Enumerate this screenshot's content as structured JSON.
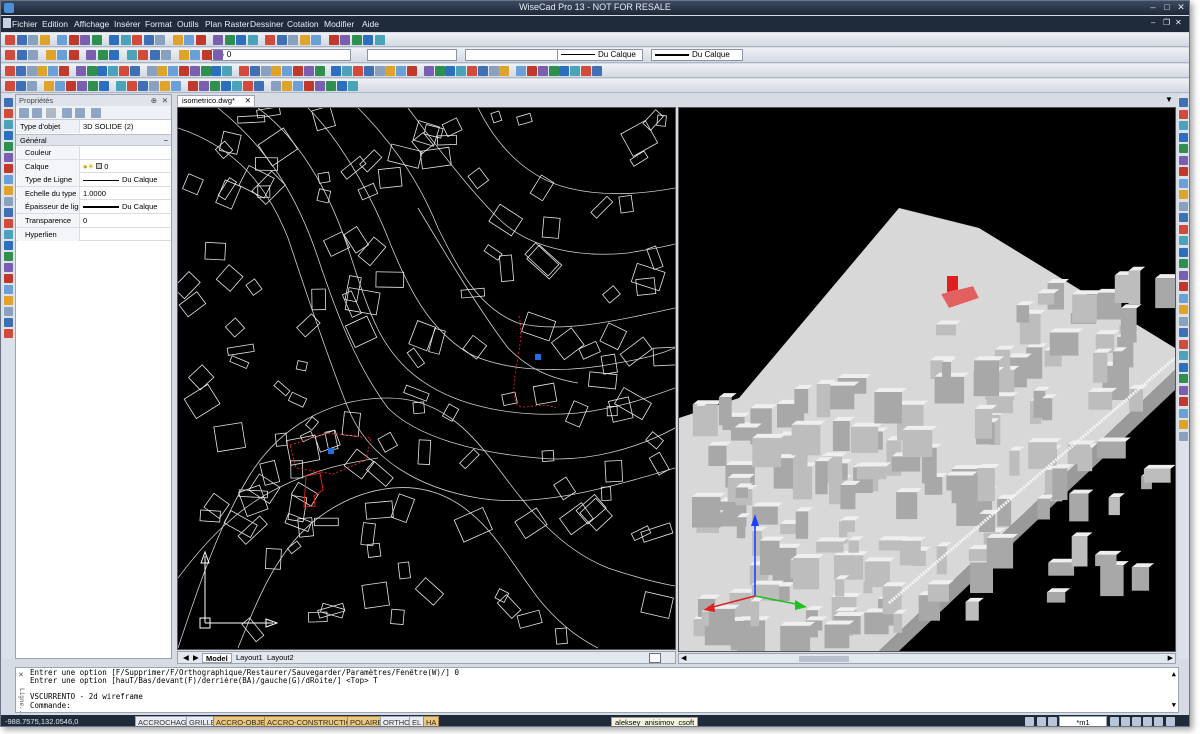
{
  "window": {
    "title": "WiseCad Pro 13 - NOT FOR RESALE",
    "accent": "#1f2a3a"
  },
  "menu": [
    "Fichier",
    "Edition",
    "Affichage",
    "Insérer",
    "Format",
    "Outils",
    "Plan Raster",
    "Dessiner",
    "Cotation",
    "Modifier",
    "Aide"
  ],
  "toolbar": {
    "layer_combo_value": "0",
    "linetype_combo": "Du Calque",
    "lineweight_combo": "Du Calque"
  },
  "properties": {
    "panel_title": "Propriétés",
    "object_type_label": "Type d'objet",
    "object_type_value": "3D SOLIDE (2)",
    "group_general": "Général",
    "rows": [
      {
        "key": "Couleur",
        "value": ""
      },
      {
        "key": "Calque",
        "value": "0"
      },
      {
        "key": "Type de Ligne",
        "value": "Du Calque"
      },
      {
        "key": "Echelle du type ...",
        "value": "1.0000"
      },
      {
        "key": "Épaisseur de ligne",
        "value": "Du Calque"
      },
      {
        "key": "Transparence",
        "value": "0"
      },
      {
        "key": "Hyperlien",
        "value": ""
      }
    ]
  },
  "document": {
    "tab_title": "isometrico.dwg*",
    "layout_tabs": [
      "Model",
      "Layout1",
      "Layout2"
    ]
  },
  "command": {
    "lines": [
      "Entrer une option [F/Supprimer/F/Orthographique/Restaurer/Sauvegarder/Paramètres/Fenêtre(W)/] 0",
      "Entrer une option [hauT/Bas/devant(F)/derrière(BA)/gauche(G)/dRoite/] <Top> T",
      "",
      "VSCURRENTO - 2d wireframe"
    ],
    "prompt": "Commande:",
    "side_label": "Ligne..."
  },
  "status": {
    "coords": "-988.7575,132.0546,0",
    "toggles": [
      {
        "label": "ACCROCHAGE",
        "on": false
      },
      {
        "label": "GRILLE",
        "on": false
      },
      {
        "label": "ACCRO-OBJET",
        "on": true
      },
      {
        "label": "ACCRO-CONSTRUCTION",
        "on": true
      },
      {
        "label": "POLAIRE",
        "on": true
      },
      {
        "label": "ORTHO",
        "on": false
      },
      {
        "label": "EL",
        "on": false
      },
      {
        "label": "HA",
        "on": true
      }
    ],
    "user": "aleksey_anisimov_csoft",
    "scale": "*m1"
  },
  "colors": {
    "selection_red": "#e0201e",
    "grip_blue": "#1e6fe0",
    "model_grey": "#d9d9d9"
  }
}
